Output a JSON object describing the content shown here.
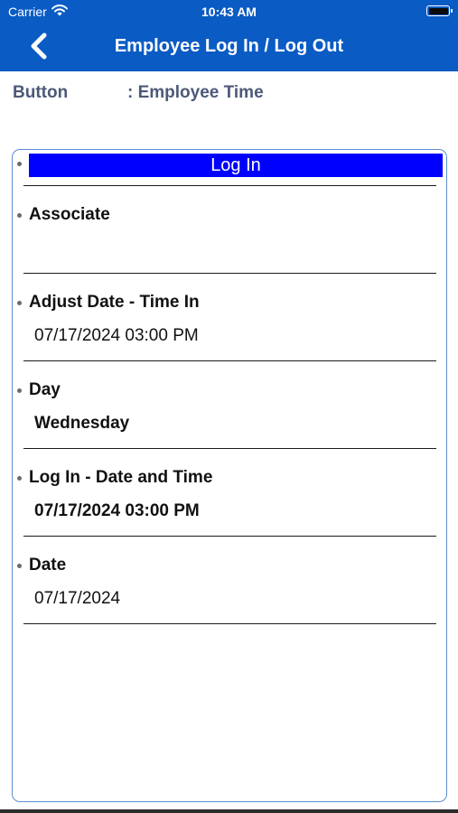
{
  "status_bar": {
    "carrier": "Carrier",
    "time": "10:43 AM"
  },
  "nav": {
    "title": "Employee Log In / Log Out",
    "back_icon": "chevron-left-icon"
  },
  "info_row": {
    "label": "Button",
    "value": ": Employee Time"
  },
  "form": {
    "login_button_label": "Log In",
    "fields": [
      {
        "label": "Associate",
        "value": ""
      },
      {
        "label": "Adjust Date - Time In",
        "value": "07/17/2024 03:00 PM"
      },
      {
        "label": "Day",
        "value": "Wednesday"
      },
      {
        "label": "Log In - Date and Time",
        "value": "07/17/2024 03:00 PM"
      },
      {
        "label": "Date",
        "value": "07/17/2024"
      }
    ]
  },
  "colors": {
    "header": "#0a5bc4",
    "login_bar": "#0000ff",
    "panel_border": "#5b8ed3",
    "info_text": "#4d5979"
  }
}
